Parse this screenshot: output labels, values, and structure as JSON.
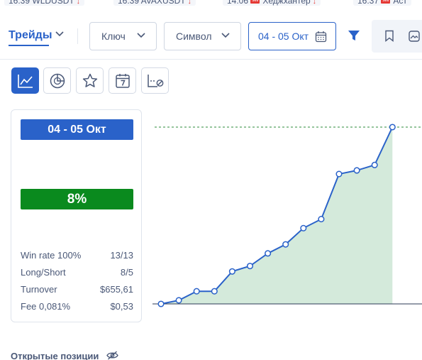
{
  "ticker": [
    {
      "time": "16:39",
      "symbol": "WLDUSDT",
      "badge": ""
    },
    {
      "time": "16:39",
      "symbol": "AVAXUSDT",
      "badge": ""
    },
    {
      "time": "14:06",
      "symbol": "Хеджхантер",
      "badge": "sell"
    },
    {
      "time": "16:37",
      "symbol": "Аст",
      "badge": "sell"
    }
  ],
  "toolbar": {
    "trades_label": "Трейды",
    "key_filter": "Ключ",
    "symbol_filter": "Символ",
    "date_filter": "04 - 05 Окт"
  },
  "stats": {
    "date_range": "04 - 05 Окт",
    "pnl_percent": "8%",
    "rows": [
      {
        "label": "Win rate 100%",
        "value": "13/13"
      },
      {
        "label": "Long/Short",
        "value": "8/5"
      },
      {
        "label": "Turnover",
        "value": "$655,61"
      },
      {
        "label": "Fee 0,081%",
        "value": "$0,53"
      }
    ]
  },
  "chart_data": {
    "type": "area",
    "x": [
      0,
      1,
      2,
      3,
      4,
      5,
      6,
      7,
      8,
      9,
      10,
      11,
      12,
      13
    ],
    "values": [
      0.0,
      0.2,
      0.7,
      0.7,
      1.8,
      2.1,
      2.8,
      3.3,
      4.2,
      4.7,
      7.2,
      7.4,
      7.7,
      9.8
    ],
    "ylim": [
      0,
      10
    ],
    "max_line": 9.8,
    "line_color": "#2a62c9",
    "fill_color": "#d4eadb",
    "max_line_color": "#2e8b3a",
    "grid": false
  },
  "open_positions_label": "Открытые позиции",
  "colors": {
    "accent": "#2a62c9",
    "profit": "#0a8a1e"
  }
}
